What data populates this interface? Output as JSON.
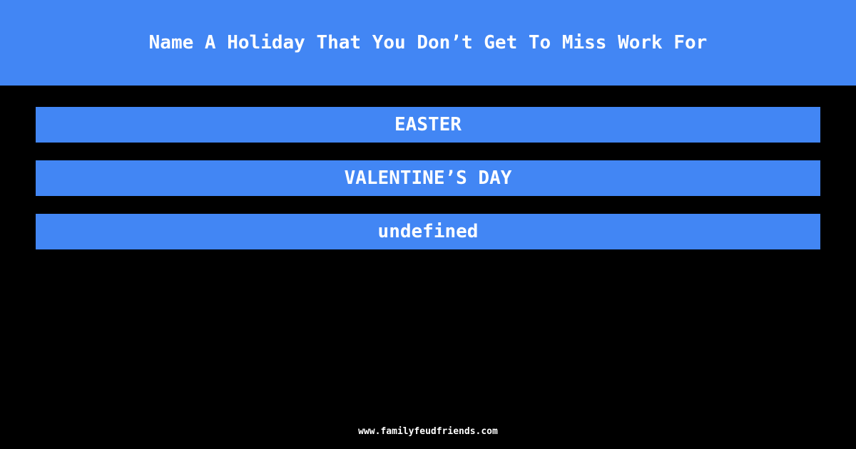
{
  "question": "Name A Holiday That You Don’t Get To Miss Work For",
  "answers": [
    {
      "label": "EASTER"
    },
    {
      "label": "VALENTINE’S DAY"
    },
    {
      "label": "undefined"
    }
  ],
  "footer": {
    "url": "www.familyfeudfriends.com"
  },
  "colors": {
    "accent": "#4286f4",
    "background": "#000000",
    "text": "#ffffff"
  }
}
